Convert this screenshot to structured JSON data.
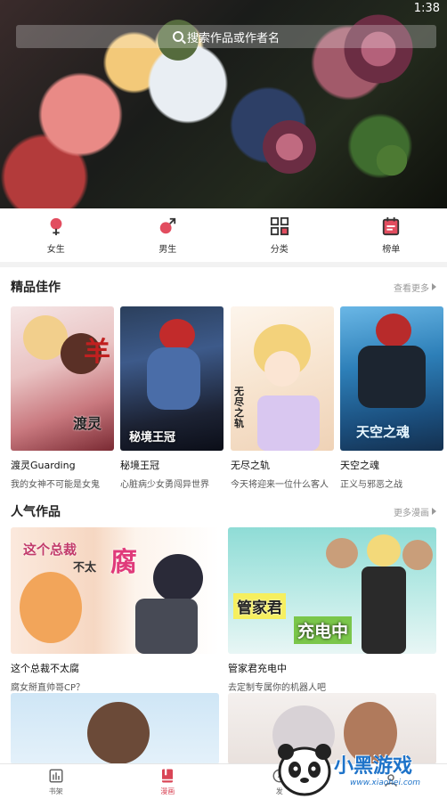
{
  "status_bar": {
    "time": "1:38"
  },
  "search": {
    "placeholder": "搜索作品或作者名"
  },
  "categories": [
    {
      "label": "女生",
      "icon": "female-icon"
    },
    {
      "label": "男生",
      "icon": "male-icon"
    },
    {
      "label": "分类",
      "icon": "grid-icon"
    },
    {
      "label": "榜单",
      "icon": "ranking-icon"
    }
  ],
  "featured": {
    "title": "精品佳作",
    "more_label": "查看更多",
    "books": [
      {
        "title": "渡灵Guarding",
        "desc": "我的女神不可能是女鬼",
        "cover_text": "渡灵"
      },
      {
        "title": "秘境王冠",
        "desc": "心脏病少女勇闯异世界",
        "cover_text": "秘境王冠"
      },
      {
        "title": "无尽之轨",
        "desc": "今天将迎来一位什么客人",
        "cover_text": "无尽之轨"
      },
      {
        "title": "天空之魂",
        "desc": "正义与邪恶之战",
        "cover_text": "天空之魂"
      }
    ]
  },
  "popular": {
    "title": "人气作品",
    "more_label": "更多漫画",
    "items": [
      {
        "title": "这个总裁不太腐",
        "desc": "腐女掰直帅哥CP？",
        "cover_text_1": "这个总裁",
        "cover_text_2": "不太",
        "cover_text_3": "腐"
      },
      {
        "title": "管家君充电中",
        "desc": "去定制专属你的机器人吧",
        "cover_text_1": "管家君",
        "cover_text_2": "充电中"
      }
    ]
  },
  "tab_bar": {
    "tabs": [
      {
        "label": "书架",
        "active": false
      },
      {
        "label": "漫画",
        "active": true
      },
      {
        "label": "发",
        "active": false
      }
    ]
  },
  "watermark": {
    "text": "小黑游戏",
    "url": "www.xiaohei.com"
  },
  "colors": {
    "accent": "#d94556",
    "background": "#f2f2f2"
  }
}
